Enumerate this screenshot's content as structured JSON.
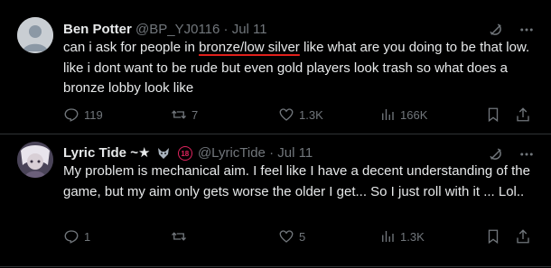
{
  "posts": [
    {
      "author_name": "Ben Potter",
      "author_handle": "@BP_YJ0116",
      "separator": "·",
      "date": "Jul 11",
      "text_before": "can i ask for people in ",
      "text_highlight": "bronze/low silver",
      "text_after": " like what are you doing to be that low. like i dont want to be rude but even gold players look trash so what does a bronze lobby look like",
      "reply_count": "119",
      "repost_count": "7",
      "like_count": "1.3K",
      "views_count": "166K"
    },
    {
      "author_name": "Lyric Tide ~",
      "name_star": "★",
      "age_badge": "18",
      "author_handle": "@LyricTide",
      "separator": "·",
      "date": "Jul 11",
      "text": "My problem is mechanical aim. I feel like I have a decent understanding of the game, but my aim only gets worse the older I get... So I just roll with it ... Lol..",
      "reply_count": "1",
      "repost_count": "",
      "like_count": "5",
      "views_count": "1.3K"
    }
  ],
  "icons": {
    "reply": "reply-icon",
    "repost": "repost-icon",
    "like": "like-icon",
    "views": "views-icon",
    "bookmark": "bookmark-icon",
    "share": "share-icon",
    "grok": "grok-icon",
    "more": "more-icon"
  },
  "colors": {
    "background": "#000000",
    "text": "#e7e9ea",
    "muted": "#71767b",
    "divider": "#2f3336",
    "highlight_underline": "#e0201b"
  }
}
